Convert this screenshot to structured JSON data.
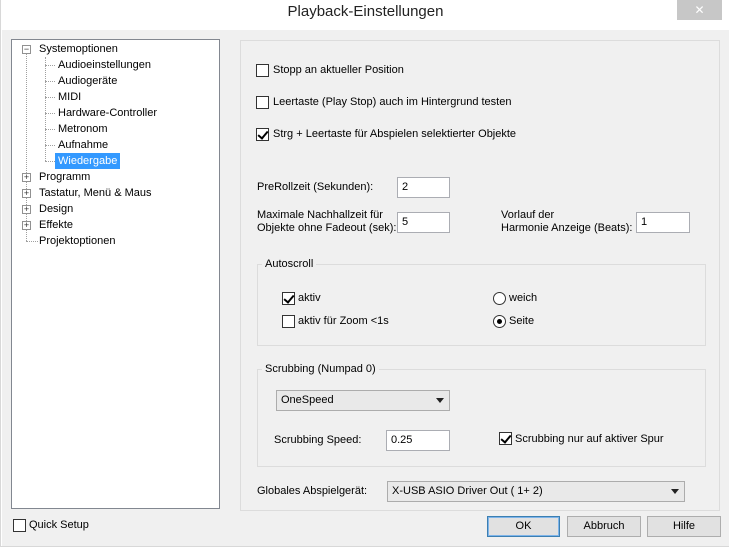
{
  "window": {
    "title": "Playback-Einstellungen",
    "close_glyph": "✕"
  },
  "tree": {
    "items": [
      {
        "label": "Systemoptionen",
        "expander": "−"
      },
      {
        "label": "Audioeinstellungen"
      },
      {
        "label": "Audiogeräte"
      },
      {
        "label": "MIDI"
      },
      {
        "label": "Hardware-Controller"
      },
      {
        "label": "Metronom"
      },
      {
        "label": "Aufnahme"
      },
      {
        "label": "Wiedergabe",
        "selected": true
      },
      {
        "label": "Programm",
        "expander": "+"
      },
      {
        "label": "Tastatur, Menü & Maus",
        "expander": "+"
      },
      {
        "label": "Design",
        "expander": "+"
      },
      {
        "label": "Effekte",
        "expander": "+"
      },
      {
        "label": "Projektoptionen"
      }
    ]
  },
  "options": {
    "stop_at_position": {
      "label": "Stopp an aktueller Position",
      "checked": false
    },
    "space_background": {
      "label": "Leertaste (Play Stop) auch im Hintergrund testen",
      "checked": false
    },
    "ctrl_space_selected": {
      "label": "Strg + Leertaste für Abspielen selektierter Objekte",
      "checked": true
    }
  },
  "fields": {
    "preroll_label": "PreRollzeit (Sekunden):",
    "preroll_value": "2",
    "max_release_label_1": "Maximale Nachhallzeit für",
    "max_release_label_2": "Objekte ohne Fadeout (sek):",
    "max_release_value": "5",
    "harmony_label_1": "Vorlauf der",
    "harmony_label_2": "Harmonie Anzeige (Beats):",
    "harmony_value": "1"
  },
  "autoscroll": {
    "title": "Autoscroll",
    "active": {
      "label": "aktiv",
      "checked": true
    },
    "zoom": {
      "label": "aktiv für Zoom <1s",
      "checked": false
    },
    "smooth": {
      "label": "weich",
      "selected": false
    },
    "page": {
      "label": "Seite",
      "selected": true
    }
  },
  "scrubbing": {
    "title": "Scrubbing  (Numpad 0)",
    "mode_value": "OneSpeed",
    "speed_label": "Scrubbing Speed:",
    "speed_value": "0.25",
    "active_track": {
      "label": "Scrubbing nur auf aktiver Spur",
      "checked": true
    }
  },
  "device": {
    "label": "Globales Abspielgerät:",
    "value": "X-USB ASIO Driver Out ( 1+ 2)"
  },
  "footer": {
    "quick_setup": {
      "label": "Quick Setup",
      "checked": false
    },
    "ok": "OK",
    "cancel": "Abbruch",
    "help": "Hilfe"
  }
}
